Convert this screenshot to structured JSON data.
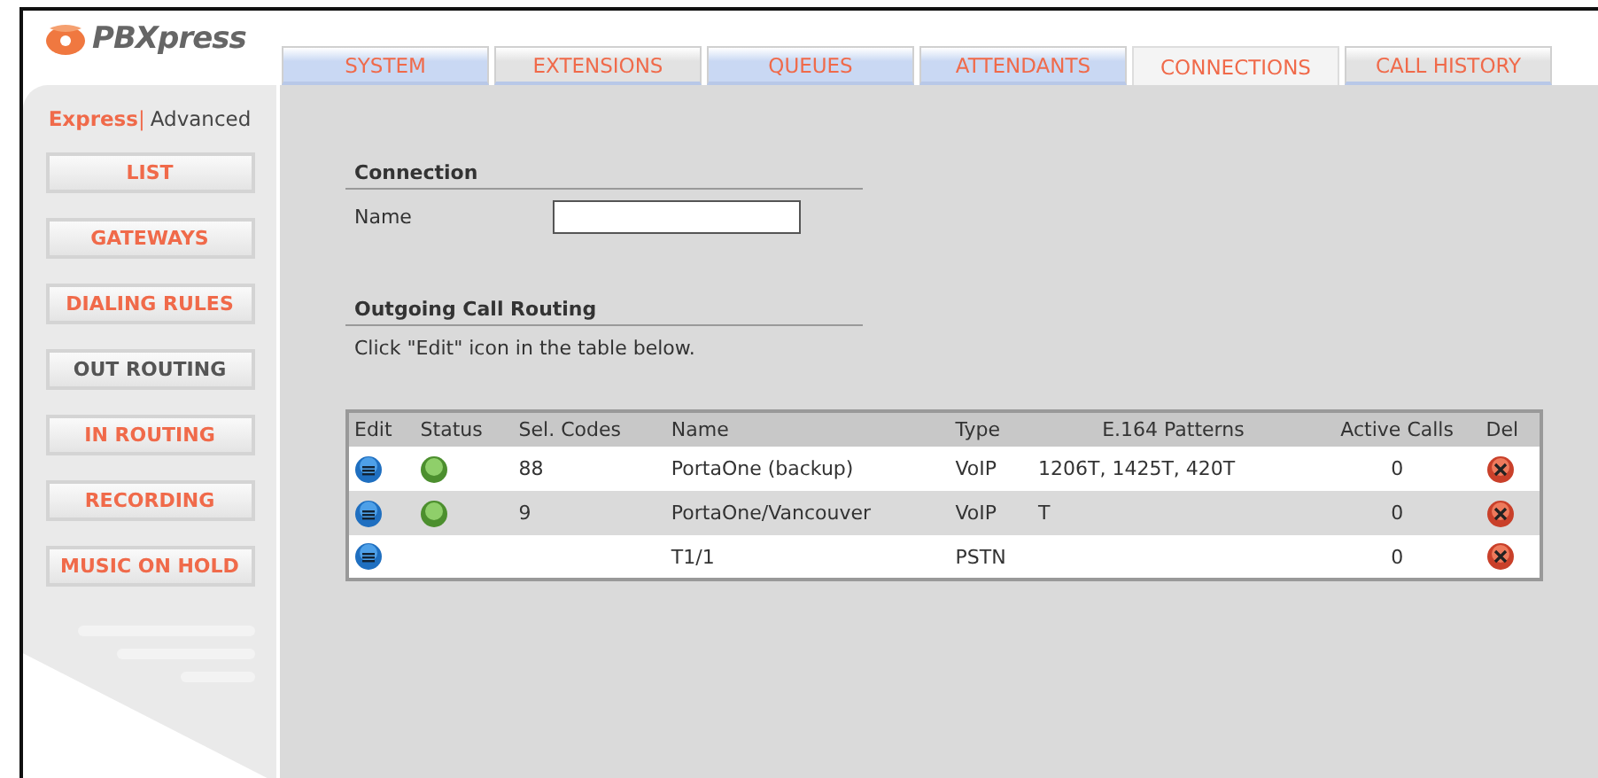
{
  "logo": {
    "text": "PBXpress"
  },
  "tabs": [
    {
      "label": "SYSTEM",
      "selected": false,
      "color": "#c9d8f3"
    },
    {
      "label": "EXTENSIONS",
      "selected": false,
      "color": "#e2e2e2"
    },
    {
      "label": "QUEUES",
      "selected": false,
      "color": "#c9d8f3"
    },
    {
      "label": "ATTENDANTS",
      "selected": false,
      "color": "#c9d8f3"
    },
    {
      "label": "CONNECTIONS",
      "selected": true,
      "color": "#e2e2e2"
    },
    {
      "label": "CALL HISTORY",
      "selected": false,
      "color": "#e2e2e2"
    }
  ],
  "mode_separator": "|",
  "modes": [
    {
      "label": "Express",
      "selected": true
    },
    {
      "label": "Advanced",
      "selected": false
    }
  ],
  "sidebar": {
    "items": [
      {
        "label": "LIST",
        "selected": false
      },
      {
        "label": "GATEWAYS",
        "selected": false
      },
      {
        "label": "DIALING RULES",
        "selected": false
      },
      {
        "label": "OUT ROUTING",
        "selected": true
      },
      {
        "label": "IN ROUTING",
        "selected": false
      },
      {
        "label": "RECORDING",
        "selected": false
      },
      {
        "label": "MUSIC ON HOLD",
        "selected": false
      }
    ]
  },
  "connection": {
    "title": "Connection",
    "name_label": "Name"
  },
  "routing": {
    "title": "Outgoing Call Routing",
    "hint": "Click \"Edit\" icon in the table below."
  },
  "table": {
    "columns": [
      "Edit",
      "Status",
      "Sel. Codes",
      "Name",
      "Type",
      "E.164 Patterns",
      "Active Calls",
      "Del"
    ],
    "rows": [
      {
        "status": true,
        "codes": "88",
        "name": "PortaOne (backup)",
        "type": "VoIP",
        "patterns": "1206T, 1425T, 420T",
        "active": "0"
      },
      {
        "status": true,
        "codes": "9",
        "name": "PortaOne/Vancouver",
        "type": "VoIP",
        "patterns": "T",
        "active": "0"
      },
      {
        "status": false,
        "name": "T1/1",
        "type": "PSTN",
        "active": "0"
      }
    ]
  }
}
